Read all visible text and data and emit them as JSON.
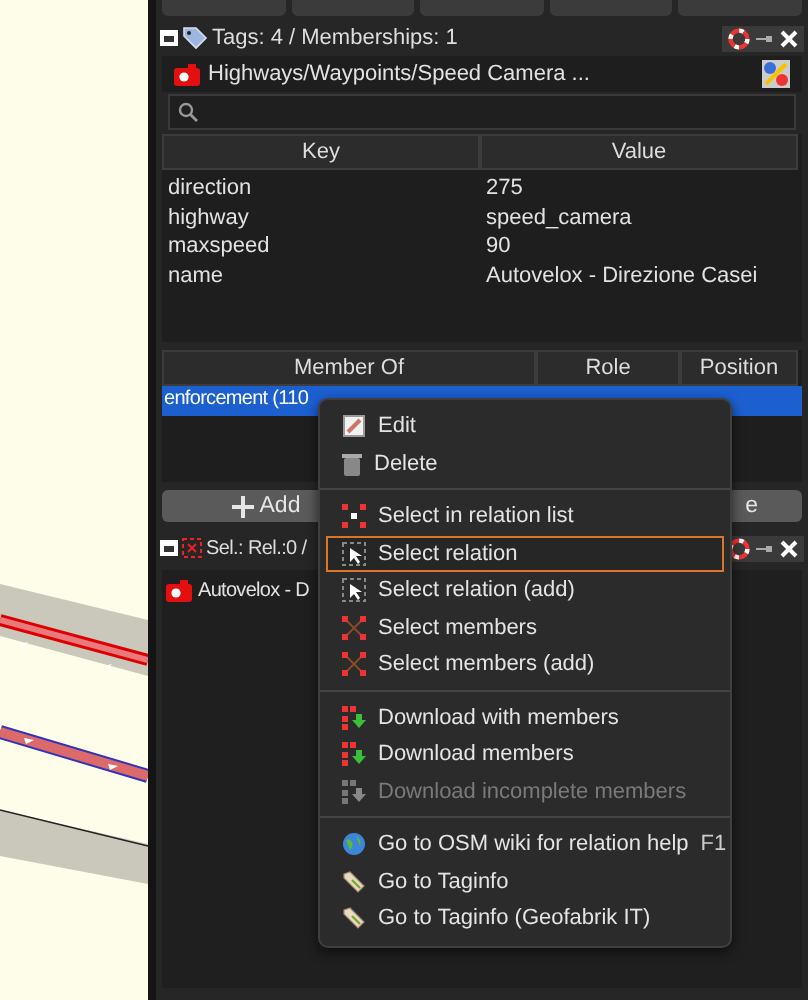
{
  "tags_panel": {
    "title": "Tags: 4 / Memberships: 1",
    "preset": "Highways/Waypoints/Speed Camera ..."
  },
  "tags_table": {
    "columns": [
      "Key",
      "Value"
    ],
    "rows": [
      [
        "direction",
        "275"
      ],
      [
        "highway",
        "speed_camera"
      ],
      [
        "maxspeed",
        "90"
      ],
      [
        "name",
        "Autovelox - Direzione Casei"
      ]
    ]
  },
  "membership_table": {
    "columns": [
      "Member Of",
      "Role",
      "Position"
    ],
    "rows": [
      {
        "member_of": "enforcement (110",
        "selected": true
      }
    ]
  },
  "buttons": [
    {
      "label": "Add"
    },
    {
      "label": "e"
    }
  ],
  "selection_panel": {
    "title": "Sel.: Rel.:0 /",
    "items": [
      "Autovelox - D"
    ]
  },
  "context_menu": {
    "items": [
      {
        "kind": "item",
        "label": "Edit",
        "selected": false,
        "disabled": false
      },
      {
        "kind": "item",
        "label": "Delete",
        "selected": false,
        "disabled": false
      },
      {
        "kind": "separator"
      },
      {
        "kind": "item",
        "label": "Select in relation list",
        "selected": false,
        "disabled": false
      },
      {
        "kind": "item",
        "label": "Select relation",
        "selected": true,
        "disabled": false
      },
      {
        "kind": "item",
        "label": "Select relation (add)",
        "selected": false,
        "disabled": false
      },
      {
        "kind": "item",
        "label": "Select members",
        "selected": false,
        "disabled": false
      },
      {
        "kind": "item",
        "label": "Select members (add)",
        "selected": false,
        "disabled": false
      },
      {
        "kind": "separator"
      },
      {
        "kind": "item",
        "label": "Download with members",
        "selected": false,
        "disabled": false
      },
      {
        "kind": "item",
        "label": "Download members",
        "selected": false,
        "disabled": false
      },
      {
        "kind": "item",
        "label": "Download incomplete members",
        "selected": false,
        "disabled": true
      },
      {
        "kind": "separator"
      },
      {
        "kind": "item",
        "label": "Go to OSM wiki for relation help",
        "shortcut": "F1",
        "selected": false,
        "disabled": false
      },
      {
        "kind": "item",
        "label": "Go to Taginfo",
        "selected": false,
        "disabled": false
      },
      {
        "kind": "item",
        "label": "Go to Taginfo (Geofabrik IT)",
        "selected": false,
        "disabled": false
      }
    ]
  }
}
